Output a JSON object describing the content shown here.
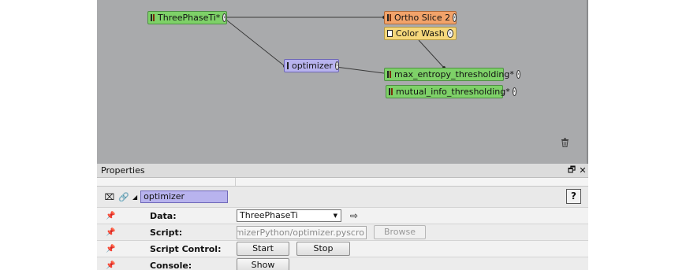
{
  "pool": {
    "nodes": {
      "threephase": {
        "label": "ThreePhaseTi*"
      },
      "ortho": {
        "label": "Ortho Slice 2"
      },
      "colorwash": {
        "label": "Color Wash"
      },
      "optimizer": {
        "label": "optimizer"
      },
      "max_entropy": {
        "label": "max_entropy_thresholding*"
      },
      "mutual_info": {
        "label": "mutual_info_thresholding*"
      }
    }
  },
  "properties": {
    "title": "Properties",
    "module_name": "optimizer",
    "help_label": "?",
    "rows": {
      "data": {
        "label": "Data:",
        "value": "ThreePhaseTi"
      },
      "script": {
        "label": "Script:",
        "value": "C:/Users/Projects/OptimizerPython/optimizer.pyscro",
        "browse": "Browse"
      },
      "control": {
        "label": "Script Control:",
        "start": "Start",
        "stop": "Stop"
      },
      "console": {
        "label": "Console:",
        "show": "Show"
      }
    }
  },
  "colors": {
    "pool_background": "#a9aaac",
    "data_node": "#7ed168",
    "display_node": "#f2a36a",
    "colormap_node": "#f5d77b",
    "script_node": "#b8b3ee"
  }
}
